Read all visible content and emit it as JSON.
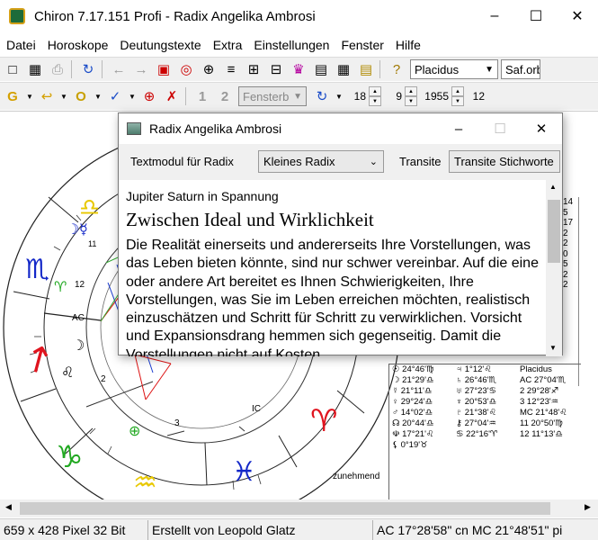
{
  "window": {
    "title": "Chiron 7.17.151 Profi - Radix Angelika Ambrosi",
    "minimize": "–",
    "maximize": "☐",
    "close": "✕"
  },
  "menu": [
    "Datei",
    "Horoskope",
    "Deutungstexte",
    "Extra",
    "Einstellungen",
    "Fenster",
    "Hilfe"
  ],
  "toolbar1": {
    "house_system": "Placidus",
    "library": "Saf.orb"
  },
  "toolbar2": {
    "num1": "1",
    "num2": "2",
    "window_combo": "Fensterb",
    "day": "18",
    "month": "9",
    "year": "1955",
    "hour": "12"
  },
  "chart": {
    "ac_label": "AC",
    "ic_label": "IC",
    "house_labels": [
      "12",
      "2",
      "3"
    ],
    "waxing_label": "zunehmend",
    "right_col_values": [
      "14",
      "5",
      "17",
      "2",
      "2",
      "0",
      "5",
      "2",
      "2"
    ],
    "table_rows": [
      [
        "☉ 24°46'♍",
        "♃ 1°12'♌",
        "Placidus"
      ],
      [
        "☽ 21°29'♎",
        "♄ 26°46'♏",
        "AC 27°04'♏"
      ],
      [
        "☿ 21°11'♎",
        "♅ 27°23'♋",
        "2 29°28'♐"
      ],
      [
        "♀ 29°24'♎",
        "♆ 20°53'♎",
        "3 12°23'♒"
      ],
      [
        "♂ 14°02'♎",
        "♇ 21°38'♌",
        "MC 21°48'♌"
      ],
      [
        "☊ 20°44'♎",
        "⚷ 27°04'♒",
        "11 20°50'♍"
      ],
      [
        "☫ 17°21'♌",
        "♋ 22°16'♈",
        "12 11°13'♎"
      ],
      [
        "⚸ 0°19'♉",
        "",
        ""
      ]
    ]
  },
  "dialog": {
    "title": "Radix Angelika Ambrosi",
    "minimize": "–",
    "maximize": "☐",
    "close": "✕",
    "module_label": "Textmodul für Radix",
    "module_value": "Kleines Radix",
    "transits_label": "Transite",
    "transits_button": "Transite Stichworte",
    "subtitle": "Jupiter Saturn in Spannung",
    "heading": "Zwischen Ideal und Wirklichkeit",
    "body": "Die Realität einerseits und andererseits Ihre Vorstellungen, was das Leben bieten könnte, sind nur schwer vereinbar. Auf die eine oder andere Art bereitet es Ihnen Schwierigkeiten, Ihre Vorstellungen, was Sie im Leben erreichen möchten, realistisch einzuschätzen und Schritt für Schritt zu verwirklichen. Vorsicht und Expansionsdrang hemmen sich gegenseitig. Damit die Vorstellungen nicht auf Kosten"
  },
  "status": {
    "image_info": "659 x 428 Pixel 32 Bit",
    "author": "Erstellt von Leopold Glatz",
    "angles": "AC 17°28'58\" cn  MC 21°48'51\" pi"
  },
  "colors": {
    "fire": "#e0141e",
    "earth": "#21a821",
    "air": "#e8c800",
    "water": "#1428c8"
  }
}
